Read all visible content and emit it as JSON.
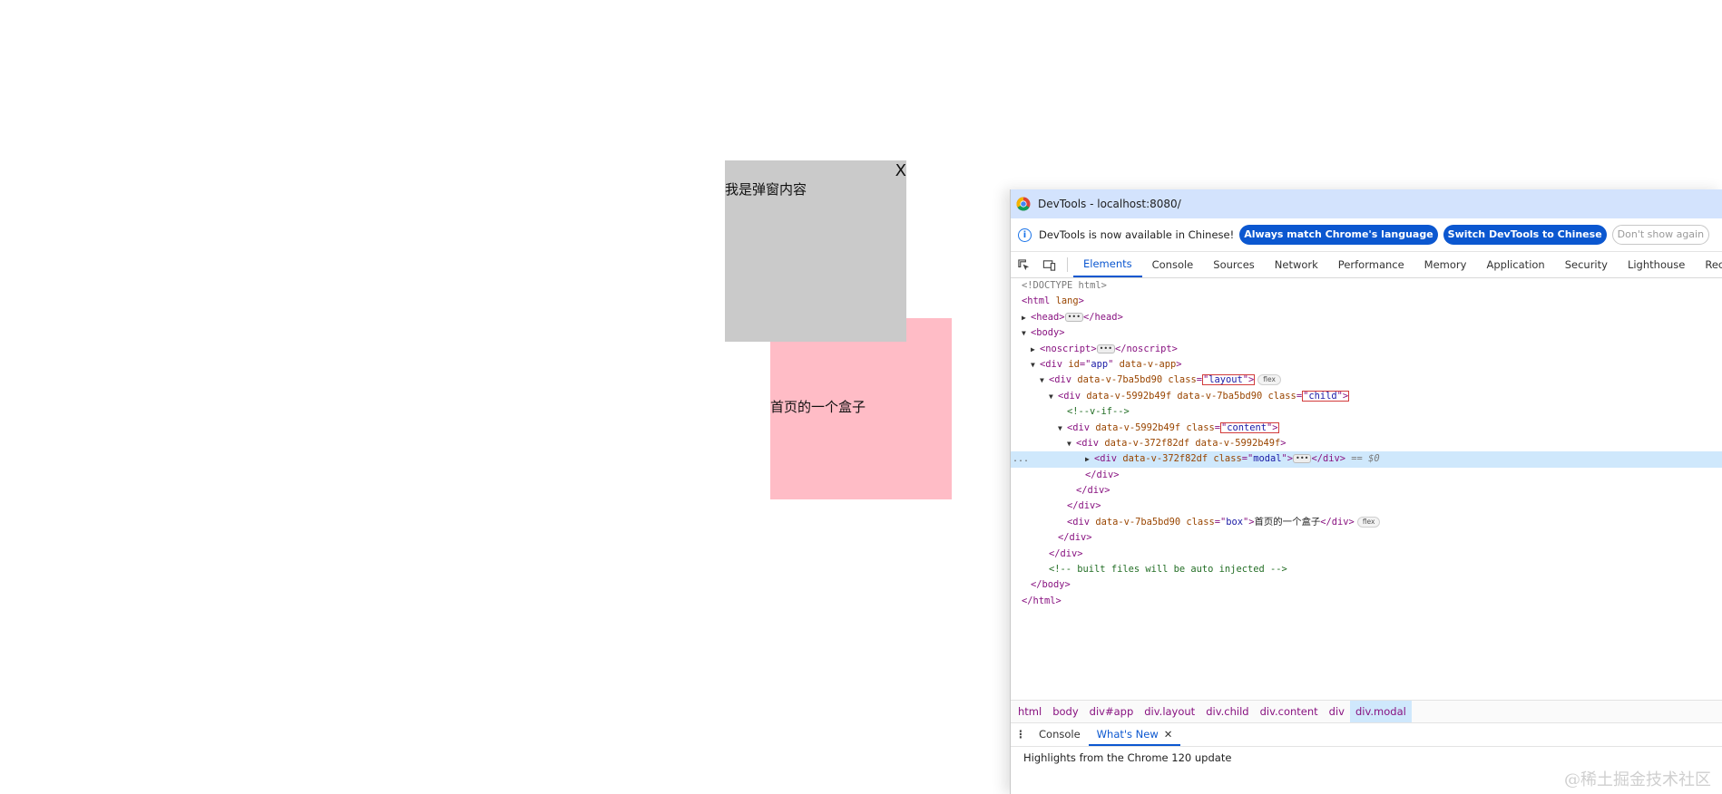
{
  "page": {
    "modal": {
      "close_label": "X",
      "text": "我是弹窗内容"
    },
    "box": {
      "text": "首页的一个盒子"
    }
  },
  "devtools": {
    "title": "DevTools - localhost:8080/",
    "infobar": {
      "message": "DevTools is now available in Chinese!",
      "btn_match": "Always match Chrome's language",
      "btn_switch": "Switch DevTools to Chinese",
      "btn_dismiss": "Don't show again"
    },
    "tabs": [
      "Elements",
      "Console",
      "Sources",
      "Network",
      "Performance",
      "Memory",
      "Application",
      "Security",
      "Lighthouse",
      "Recorder"
    ],
    "active_tab": "Elements",
    "dom": {
      "doctype": "<!DOCTYPE html>",
      "html_open_tag": "html",
      "html_lang_attr": "lang",
      "head": "head",
      "body": "body",
      "noscript": "noscript",
      "div": "div",
      "attr_id": "id",
      "val_app": "app",
      "attr_v_app": "data-v-app",
      "attr_v1": "data-v-7ba5bd90",
      "attr_v2": "data-v-5992b49f",
      "attr_v3": "data-v-372f82df",
      "attr_class": "class",
      "val_layout": "layout",
      "val_child": "child",
      "val_content": "content",
      "val_modal": "modal",
      "val_box": "box",
      "comment_vif": "<!--v-if-->",
      "comment_built": "<!-- built files will be auto injected -->",
      "box_text": "首页的一个盒子",
      "badge_flex": "flex",
      "selected_marker": "== $0",
      "dots": "..."
    },
    "breadcrumb": [
      "html",
      "body",
      "div#app",
      "div.layout",
      "div.child",
      "div.content",
      "div",
      "div.modal"
    ],
    "drawer_tabs": [
      "Console",
      "What's New"
    ],
    "drawer_active": "What's New",
    "drawer_content": "Highlights from the Chrome 120 update"
  },
  "watermark": "@稀土掘金技术社区"
}
